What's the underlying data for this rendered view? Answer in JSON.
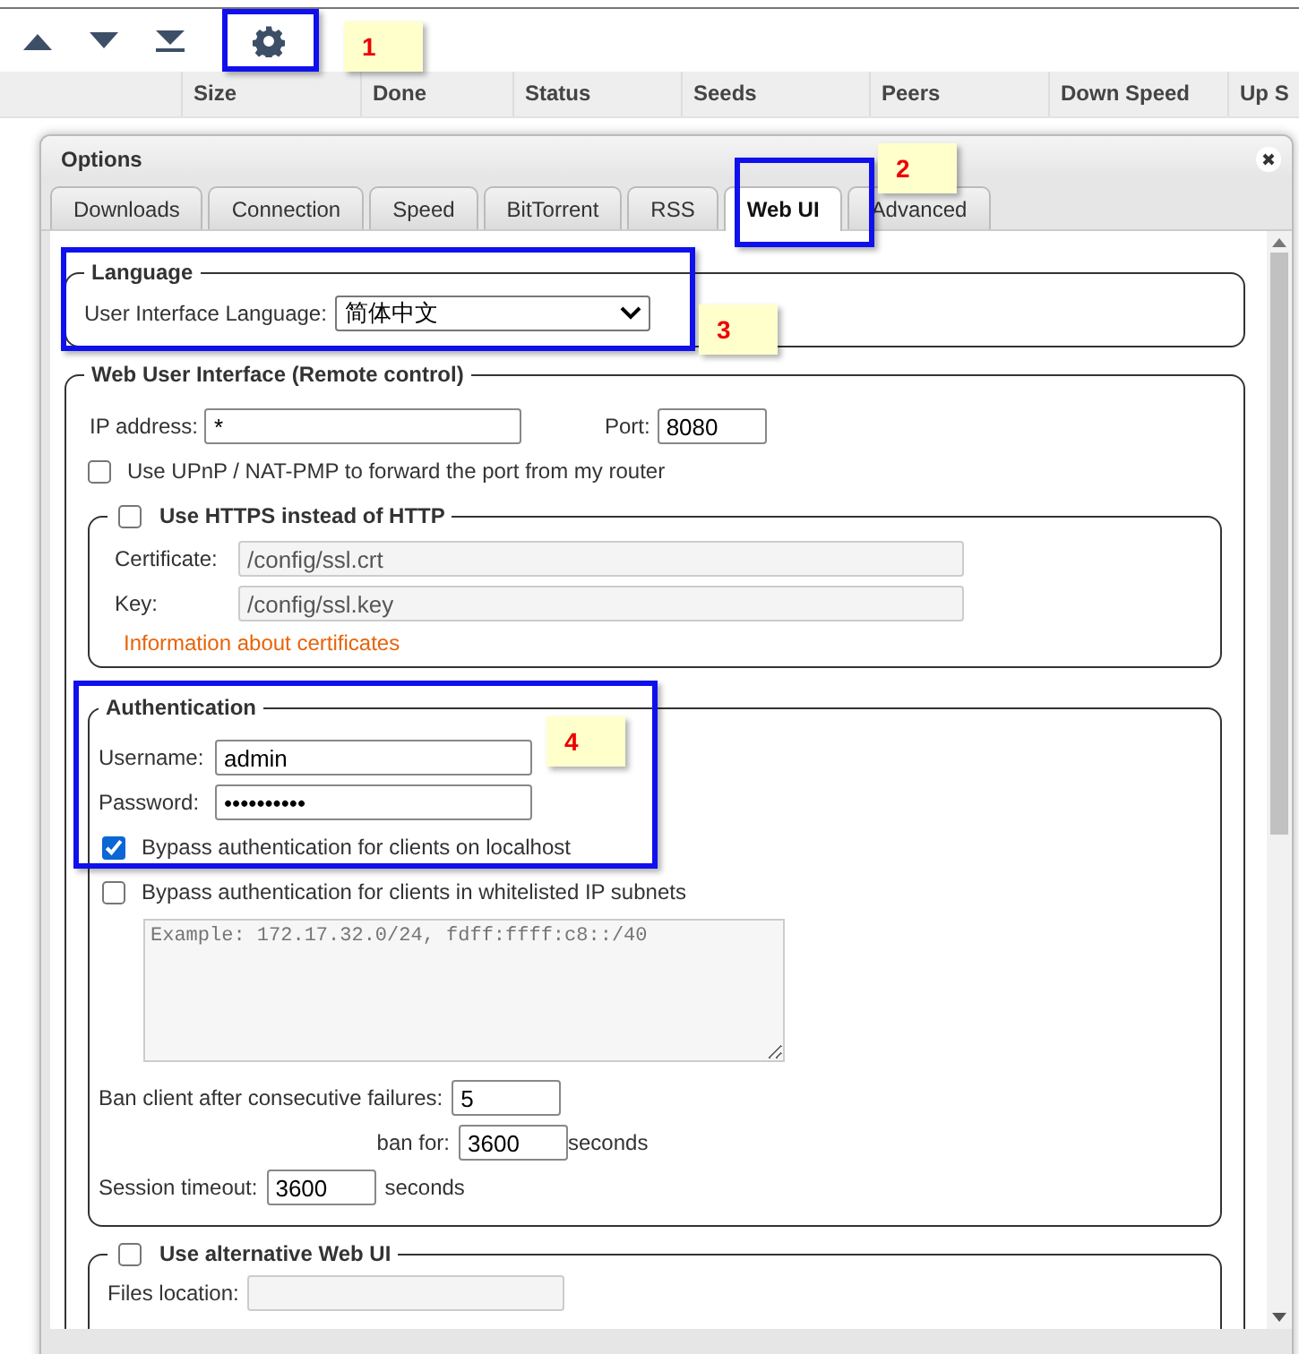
{
  "toolbar": {
    "buttons": [
      {
        "kind": "up"
      },
      {
        "kind": "down"
      },
      {
        "kind": "bottom"
      },
      {
        "kind": "gear"
      }
    ]
  },
  "columns": [
    "Size",
    "Done",
    "Status",
    "Seeds",
    "Peers",
    "Down Speed",
    "Up S"
  ],
  "dialog": {
    "title": "Options"
  },
  "tabs": [
    {
      "label": "Downloads",
      "selected": false
    },
    {
      "label": "Connection",
      "selected": false
    },
    {
      "label": "Speed",
      "selected": false
    },
    {
      "label": "BitTorrent",
      "selected": false
    },
    {
      "label": "RSS",
      "selected": false
    },
    {
      "label": "Web UI",
      "selected": true
    },
    {
      "label": "Advanced",
      "selected": false
    }
  ],
  "language": {
    "legend": "Language",
    "label": "User Interface Language:",
    "value": "简体中文"
  },
  "webui": {
    "legend": "Web User Interface (Remote control)",
    "ip_label": "IP address:",
    "ip_value": "*",
    "port_label": "Port:",
    "port_value": "8080",
    "upnp_label": "Use UPnP / NAT-PMP to forward the port from my router",
    "upnp_checked": false
  },
  "https": {
    "label": "Use HTTPS instead of HTTP",
    "checked": false,
    "certificate_label": "Certificate:",
    "certificate_value": "/config/ssl.crt",
    "key_label": "Key:",
    "key_value": "/config/ssl.key",
    "info_link": "Information about certificates"
  },
  "authentication": {
    "legend": "Authentication",
    "username_label": "Username:",
    "username_value": "admin",
    "password_label": "Password:",
    "password_value": "••••••••••",
    "bypass_localhost_label": "Bypass authentication for clients on localhost",
    "bypass_localhost_checked": true,
    "bypass_whitelist_label": "Bypass authentication for clients in whitelisted IP subnets",
    "bypass_whitelist_checked": false,
    "whitelist_placeholder": "Example: 172.17.32.0/24, fdff:ffff:c8::/40",
    "ban_label": "Ban client after consecutive failures:",
    "ban_value": "5",
    "ban_for_label": "ban for:",
    "ban_for_value": "3600",
    "ban_for_unit": "seconds",
    "session_label": "Session timeout:",
    "session_value": "3600",
    "session_unit": "seconds"
  },
  "alt_webui": {
    "label": "Use alternative Web UI",
    "checked": false,
    "files_label": "Files location:"
  },
  "annotations": [
    {
      "label": "1"
    },
    {
      "label": "2"
    },
    {
      "label": "3"
    },
    {
      "label": "4"
    }
  ]
}
